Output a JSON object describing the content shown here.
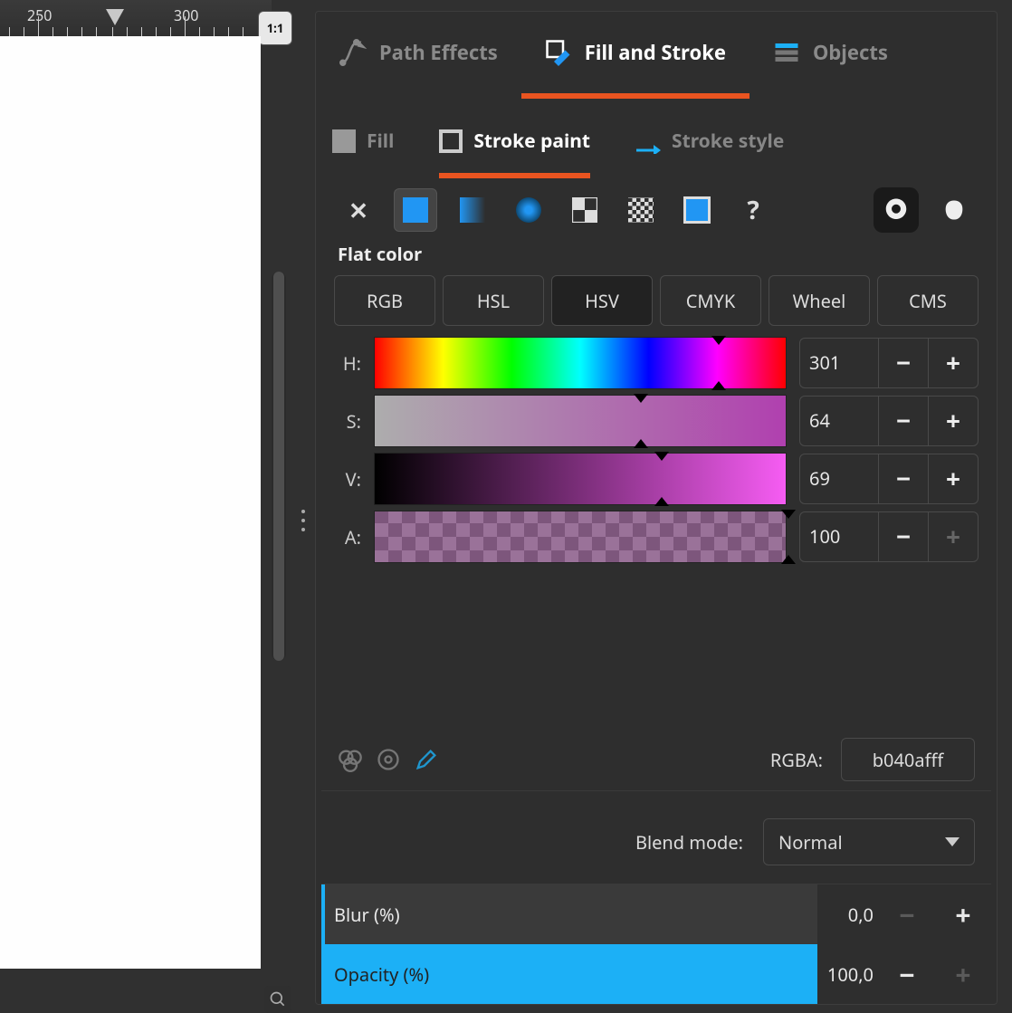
{
  "ruler": {
    "mark1": "250",
    "mark2": "300"
  },
  "zoom_badge": "1:1",
  "tabs": {
    "path_effects": "Path Effects",
    "fill_and_stroke": "Fill and Stroke",
    "objects": "Objects"
  },
  "subtabs": {
    "fill": "Fill",
    "stroke_paint": "Stroke paint",
    "stroke_style": "Stroke style"
  },
  "section_flat_color": "Flat color",
  "color_models": {
    "rgb": "RGB",
    "hsl": "HSL",
    "hsv": "HSV",
    "cmyk": "CMYK",
    "wheel": "Wheel",
    "cms": "CMS"
  },
  "channels": {
    "h": {
      "label": "H:",
      "value": "301"
    },
    "s": {
      "label": "S:",
      "value": "64"
    },
    "v": {
      "label": "V:",
      "value": "69"
    },
    "a": {
      "label": "A:",
      "value": "100"
    }
  },
  "rgba": {
    "label": "RGBA:",
    "value": "b040afff"
  },
  "blend": {
    "label": "Blend mode:",
    "value": "Normal"
  },
  "blur": {
    "label": "Blur (%)",
    "value": "0,0"
  },
  "opacity": {
    "label": "Opacity (%)",
    "value": "100,0"
  },
  "colors": {
    "orange": "#e95420",
    "blue": "#1cb0f6",
    "swatch": "#2196f3",
    "stroke_color": "#b040af"
  }
}
